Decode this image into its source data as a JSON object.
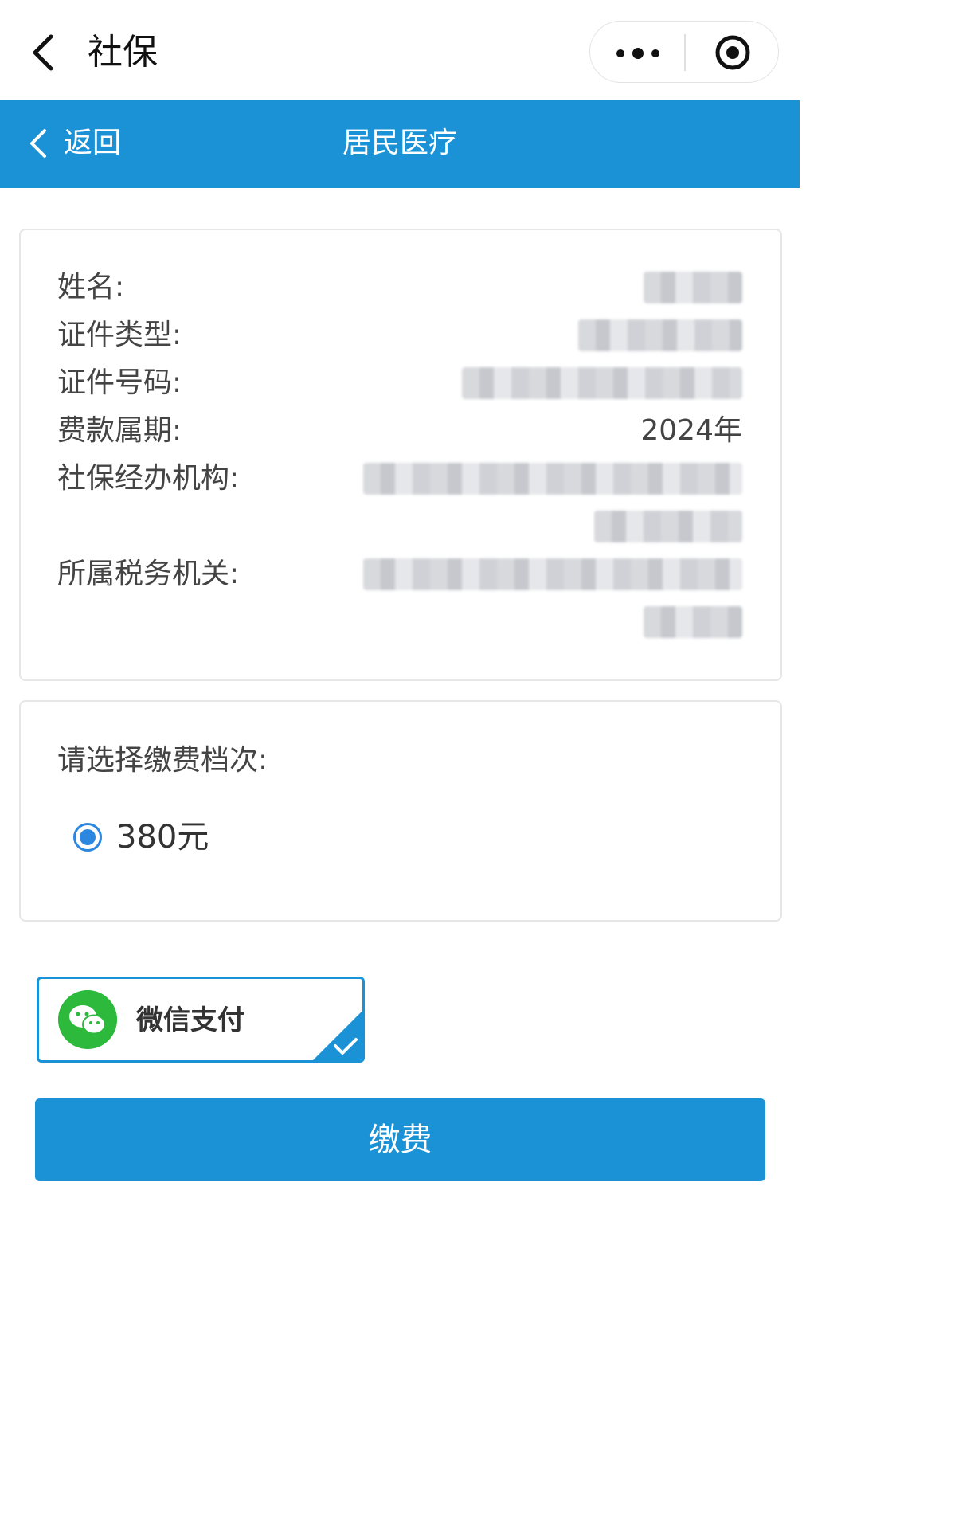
{
  "topnav": {
    "title": "社保"
  },
  "header": {
    "back_label": "返回",
    "title": "居民医疗"
  },
  "info": {
    "rows": [
      {
        "label": "姓名:"
      },
      {
        "label": "证件类型:"
      },
      {
        "label": "证件号码:"
      },
      {
        "label": "费款属期:",
        "value": "2024年"
      },
      {
        "label": "社保经办机构:"
      },
      {
        "label": "所属税务机关:"
      }
    ]
  },
  "tier": {
    "title": "请选择缴费档次:",
    "options": [
      {
        "label": "380元",
        "selected": true
      }
    ]
  },
  "payment": {
    "method_label": "微信支付",
    "selected": true
  },
  "submit": {
    "label": "缴费"
  },
  "colors": {
    "primary": "#1b92d6",
    "radio": "#2c87e0",
    "wechat": "#2dba3c"
  },
  "icons": [
    "chevron-left-icon",
    "more-dots-icon",
    "target-icon",
    "wechat-icon",
    "checkmark-icon"
  ]
}
